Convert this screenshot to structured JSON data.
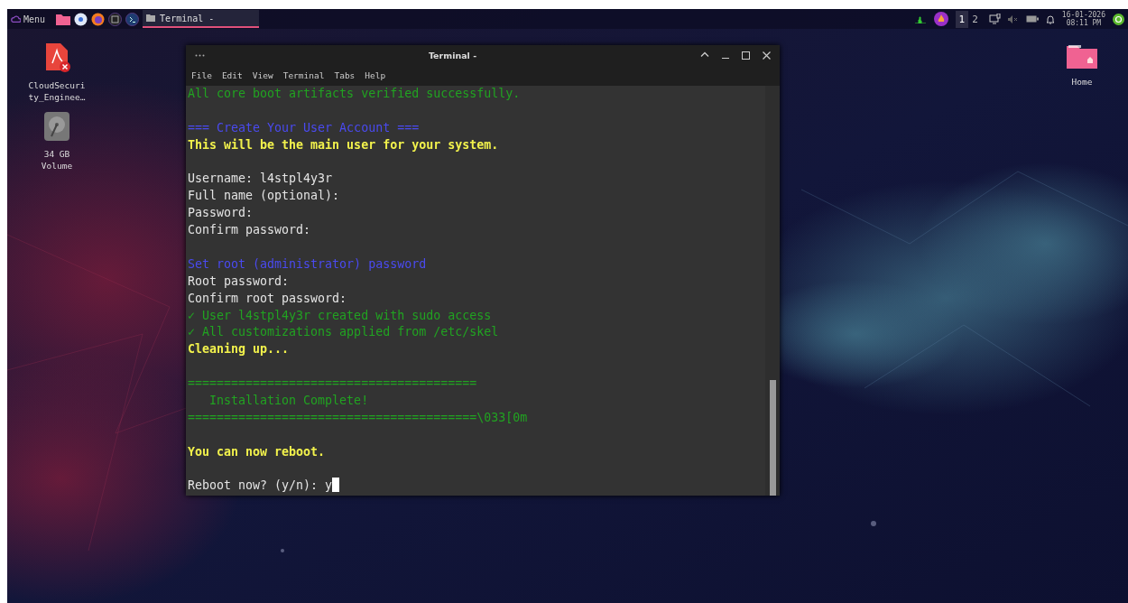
{
  "taskbar": {
    "menu_label": "Menu",
    "task": {
      "label": "Terminal -",
      "selected": true
    },
    "workspaces": [
      {
        "label": "1",
        "selected": true
      },
      {
        "label": "2",
        "selected": false
      }
    ],
    "clock": {
      "date": "16-01-2026",
      "time": "08:11 PM"
    }
  },
  "desktop_icons": [
    {
      "kind": "pdf",
      "label": "CloudSecurity_Enginee…"
    },
    {
      "kind": "drive",
      "label": "34 GB Volume"
    },
    {
      "kind": "home",
      "label": "Home"
    }
  ],
  "terminal": {
    "title": "Terminal -",
    "menu": [
      "File",
      "Edit",
      "View",
      "Terminal",
      "Tabs",
      "Help"
    ],
    "lines": [
      {
        "kind": "green",
        "text": "All core boot artifacts verified successfully."
      },
      {
        "kind": "blank"
      },
      {
        "kind": "blue",
        "text": "=== Create Your User Account ==="
      },
      {
        "kind": "yellow",
        "text": "This will be the main user for your system."
      },
      {
        "kind": "blank"
      },
      {
        "kind": "white",
        "text": "Username: l4stpl4y3r"
      },
      {
        "kind": "white",
        "text": "Full name (optional):"
      },
      {
        "kind": "white",
        "text": "Password:"
      },
      {
        "kind": "white",
        "text": "Confirm password:"
      },
      {
        "kind": "blank"
      },
      {
        "kind": "blue",
        "text": "Set root (administrator) password"
      },
      {
        "kind": "white",
        "text": "Root password:"
      },
      {
        "kind": "white",
        "text": "Confirm root password:"
      },
      {
        "kind": "green",
        "text": "✓ User l4stpl4y3r created with sudo access"
      },
      {
        "kind": "green",
        "text": "✓ All customizations applied from /etc/skel"
      },
      {
        "kind": "yellow",
        "text": "Cleaning up..."
      },
      {
        "kind": "blank"
      },
      {
        "kind": "green",
        "text": "========================================"
      },
      {
        "kind": "green",
        "text": "   Installation Complete!"
      },
      {
        "kind": "green",
        "text": "========================================\\033[0m"
      },
      {
        "kind": "blank"
      },
      {
        "kind": "yellow",
        "text": "You can now reboot."
      },
      {
        "kind": "blank"
      },
      {
        "kind": "prompt",
        "text": "Reboot now? (y/n): y"
      }
    ]
  }
}
